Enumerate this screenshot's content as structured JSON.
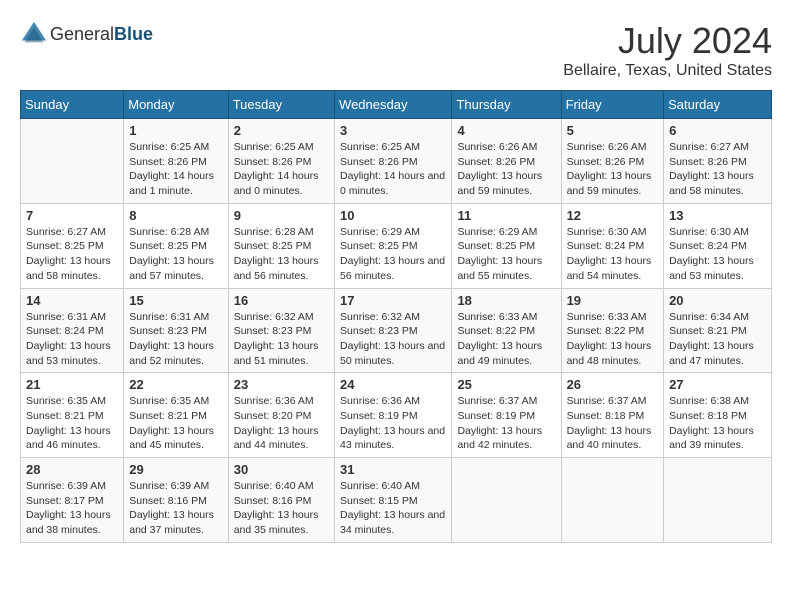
{
  "header": {
    "logo_general": "General",
    "logo_blue": "Blue",
    "title": "July 2024",
    "subtitle": "Bellaire, Texas, United States"
  },
  "calendar": {
    "days_of_week": [
      "Sunday",
      "Monday",
      "Tuesday",
      "Wednesday",
      "Thursday",
      "Friday",
      "Saturday"
    ],
    "weeks": [
      [
        {
          "date": "",
          "sunrise": "",
          "sunset": "",
          "daylight": ""
        },
        {
          "date": "1",
          "sunrise": "Sunrise: 6:25 AM",
          "sunset": "Sunset: 8:26 PM",
          "daylight": "Daylight: 14 hours and 1 minute."
        },
        {
          "date": "2",
          "sunrise": "Sunrise: 6:25 AM",
          "sunset": "Sunset: 8:26 PM",
          "daylight": "Daylight: 14 hours and 0 minutes."
        },
        {
          "date": "3",
          "sunrise": "Sunrise: 6:25 AM",
          "sunset": "Sunset: 8:26 PM",
          "daylight": "Daylight: 14 hours and 0 minutes."
        },
        {
          "date": "4",
          "sunrise": "Sunrise: 6:26 AM",
          "sunset": "Sunset: 8:26 PM",
          "daylight": "Daylight: 13 hours and 59 minutes."
        },
        {
          "date": "5",
          "sunrise": "Sunrise: 6:26 AM",
          "sunset": "Sunset: 8:26 PM",
          "daylight": "Daylight: 13 hours and 59 minutes."
        },
        {
          "date": "6",
          "sunrise": "Sunrise: 6:27 AM",
          "sunset": "Sunset: 8:26 PM",
          "daylight": "Daylight: 13 hours and 58 minutes."
        }
      ],
      [
        {
          "date": "7",
          "sunrise": "Sunrise: 6:27 AM",
          "sunset": "Sunset: 8:25 PM",
          "daylight": "Daylight: 13 hours and 58 minutes."
        },
        {
          "date": "8",
          "sunrise": "Sunrise: 6:28 AM",
          "sunset": "Sunset: 8:25 PM",
          "daylight": "Daylight: 13 hours and 57 minutes."
        },
        {
          "date": "9",
          "sunrise": "Sunrise: 6:28 AM",
          "sunset": "Sunset: 8:25 PM",
          "daylight": "Daylight: 13 hours and 56 minutes."
        },
        {
          "date": "10",
          "sunrise": "Sunrise: 6:29 AM",
          "sunset": "Sunset: 8:25 PM",
          "daylight": "Daylight: 13 hours and 56 minutes."
        },
        {
          "date": "11",
          "sunrise": "Sunrise: 6:29 AM",
          "sunset": "Sunset: 8:25 PM",
          "daylight": "Daylight: 13 hours and 55 minutes."
        },
        {
          "date": "12",
          "sunrise": "Sunrise: 6:30 AM",
          "sunset": "Sunset: 8:24 PM",
          "daylight": "Daylight: 13 hours and 54 minutes."
        },
        {
          "date": "13",
          "sunrise": "Sunrise: 6:30 AM",
          "sunset": "Sunset: 8:24 PM",
          "daylight": "Daylight: 13 hours and 53 minutes."
        }
      ],
      [
        {
          "date": "14",
          "sunrise": "Sunrise: 6:31 AM",
          "sunset": "Sunset: 8:24 PM",
          "daylight": "Daylight: 13 hours and 53 minutes."
        },
        {
          "date": "15",
          "sunrise": "Sunrise: 6:31 AM",
          "sunset": "Sunset: 8:23 PM",
          "daylight": "Daylight: 13 hours and 52 minutes."
        },
        {
          "date": "16",
          "sunrise": "Sunrise: 6:32 AM",
          "sunset": "Sunset: 8:23 PM",
          "daylight": "Daylight: 13 hours and 51 minutes."
        },
        {
          "date": "17",
          "sunrise": "Sunrise: 6:32 AM",
          "sunset": "Sunset: 8:23 PM",
          "daylight": "Daylight: 13 hours and 50 minutes."
        },
        {
          "date": "18",
          "sunrise": "Sunrise: 6:33 AM",
          "sunset": "Sunset: 8:22 PM",
          "daylight": "Daylight: 13 hours and 49 minutes."
        },
        {
          "date": "19",
          "sunrise": "Sunrise: 6:33 AM",
          "sunset": "Sunset: 8:22 PM",
          "daylight": "Daylight: 13 hours and 48 minutes."
        },
        {
          "date": "20",
          "sunrise": "Sunrise: 6:34 AM",
          "sunset": "Sunset: 8:21 PM",
          "daylight": "Daylight: 13 hours and 47 minutes."
        }
      ],
      [
        {
          "date": "21",
          "sunrise": "Sunrise: 6:35 AM",
          "sunset": "Sunset: 8:21 PM",
          "daylight": "Daylight: 13 hours and 46 minutes."
        },
        {
          "date": "22",
          "sunrise": "Sunrise: 6:35 AM",
          "sunset": "Sunset: 8:21 PM",
          "daylight": "Daylight: 13 hours and 45 minutes."
        },
        {
          "date": "23",
          "sunrise": "Sunrise: 6:36 AM",
          "sunset": "Sunset: 8:20 PM",
          "daylight": "Daylight: 13 hours and 44 minutes."
        },
        {
          "date": "24",
          "sunrise": "Sunrise: 6:36 AM",
          "sunset": "Sunset: 8:19 PM",
          "daylight": "Daylight: 13 hours and 43 minutes."
        },
        {
          "date": "25",
          "sunrise": "Sunrise: 6:37 AM",
          "sunset": "Sunset: 8:19 PM",
          "daylight": "Daylight: 13 hours and 42 minutes."
        },
        {
          "date": "26",
          "sunrise": "Sunrise: 6:37 AM",
          "sunset": "Sunset: 8:18 PM",
          "daylight": "Daylight: 13 hours and 40 minutes."
        },
        {
          "date": "27",
          "sunrise": "Sunrise: 6:38 AM",
          "sunset": "Sunset: 8:18 PM",
          "daylight": "Daylight: 13 hours and 39 minutes."
        }
      ],
      [
        {
          "date": "28",
          "sunrise": "Sunrise: 6:39 AM",
          "sunset": "Sunset: 8:17 PM",
          "daylight": "Daylight: 13 hours and 38 minutes."
        },
        {
          "date": "29",
          "sunrise": "Sunrise: 6:39 AM",
          "sunset": "Sunset: 8:16 PM",
          "daylight": "Daylight: 13 hours and 37 minutes."
        },
        {
          "date": "30",
          "sunrise": "Sunrise: 6:40 AM",
          "sunset": "Sunset: 8:16 PM",
          "daylight": "Daylight: 13 hours and 35 minutes."
        },
        {
          "date": "31",
          "sunrise": "Sunrise: 6:40 AM",
          "sunset": "Sunset: 8:15 PM",
          "daylight": "Daylight: 13 hours and 34 minutes."
        },
        {
          "date": "",
          "sunrise": "",
          "sunset": "",
          "daylight": ""
        },
        {
          "date": "",
          "sunrise": "",
          "sunset": "",
          "daylight": ""
        },
        {
          "date": "",
          "sunrise": "",
          "sunset": "",
          "daylight": ""
        }
      ]
    ]
  }
}
